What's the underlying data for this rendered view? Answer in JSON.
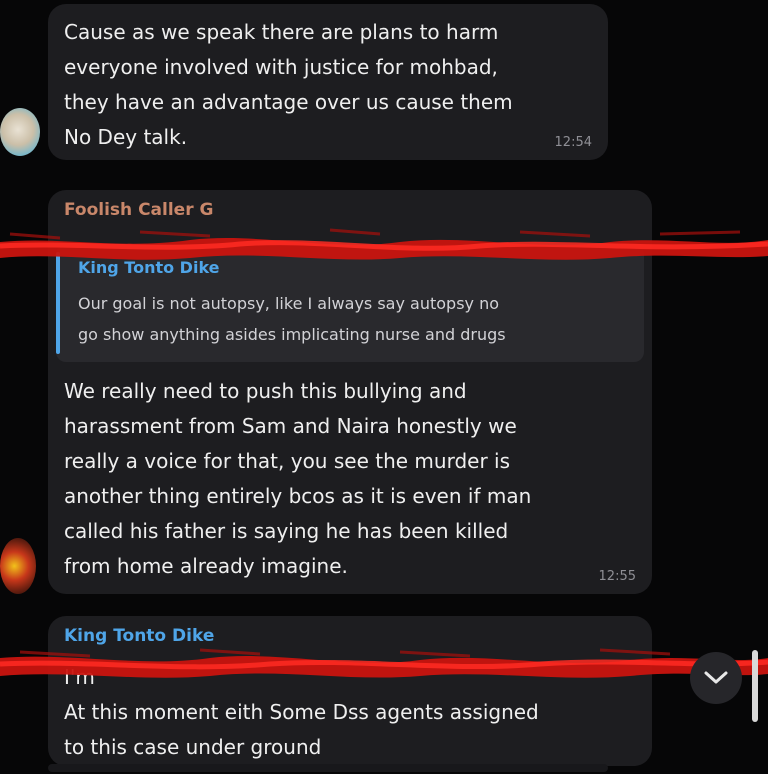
{
  "messages": [
    {
      "text": "Cause as we speak there are plans to harm\neveryone involved with justice for mohbad,\nthey have an advantage over us cause them\nNo Dey talk.",
      "time": "12:54"
    },
    {
      "sender": "Foolish Caller G",
      "reply_to": {
        "author": "King Tonto Dike",
        "text": "Our goal is not autopsy, like I always say autopsy no\ngo show anything asides implicating nurse and drugs"
      },
      "text": "We really need to push this bullying and\nharassment from Sam and Naira honestly we\nreally a voice for that, you see the murder is\nanother thing entirely bcos as it is even if man\ncalled his father is saying he has been killed\nfrom home already imagine.",
      "time": "12:55"
    },
    {
      "sender": "King Tonto Dike",
      "text": "I'm\nAt this moment eith Some Dss agents assigned\nto this case under ground"
    }
  ],
  "colors": {
    "background": "#060607",
    "bubble": "#1d1d20",
    "sender_orange": "#c9876a",
    "sender_blue": "#4fa5e8",
    "redaction_red": "#d11414"
  },
  "icons": {
    "scroll_down": "chevron-down-icon"
  }
}
